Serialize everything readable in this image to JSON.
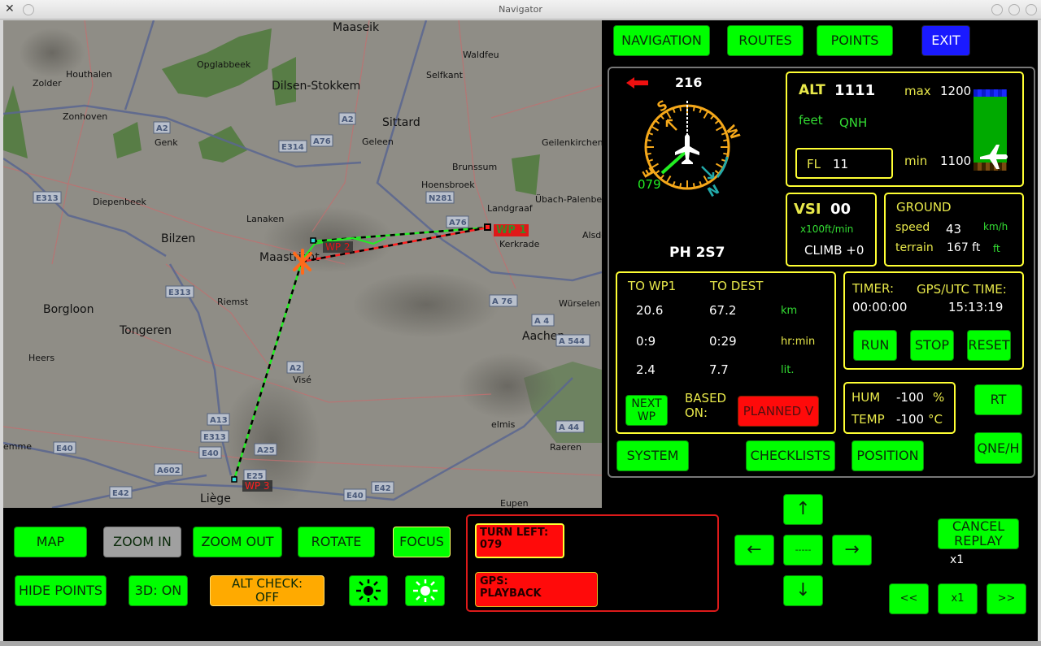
{
  "window": {
    "title": "Navigator"
  },
  "top_nav": {
    "navigation": "NAVIGATION",
    "routes": "ROUTES",
    "points": "POINTS",
    "exit": "EXIT"
  },
  "compass": {
    "heading": "216",
    "bearing": "079",
    "callsign": "PH 2S7",
    "cardinals": {
      "s": "S",
      "w": "W",
      "n": "N",
      "e": "E"
    },
    "turn_direction": "left"
  },
  "altitude": {
    "label": "ALT",
    "value": "1111",
    "unit": "feet",
    "mode": "QNH",
    "max_label": "max",
    "max_value": "1200",
    "min_label": "min",
    "min_value": "1100",
    "fl_label": "FL",
    "fl_value": "11",
    "bar_fraction": 0.11
  },
  "vsi": {
    "label": "VSI",
    "value": "00",
    "unit": "x100ft/min",
    "climb": "CLIMB +0"
  },
  "ground": {
    "title": "GROUND",
    "speed_label": "speed",
    "speed_value": "43",
    "speed_unit": "km/h",
    "terrain_label": "terrain",
    "terrain_value": "167 ft",
    "terrain_unit": "ft"
  },
  "route": {
    "col1": "TO WP1",
    "col2": "TO DEST",
    "rows": [
      {
        "a": "20.6",
        "b": "67.2",
        "unit": "km"
      },
      {
        "a": "0:9",
        "b": "0:29",
        "unit": "hr:min"
      },
      {
        "a": "2.4",
        "b": "7.7",
        "unit": "lit."
      }
    ],
    "next_wp": "NEXT WP",
    "based_on": "BASED ON:",
    "planned": "PLANNED V"
  },
  "timer": {
    "label": "TIMER:",
    "value": "00:00:00",
    "gps_label": "GPS/UTC TIME:",
    "gps_value": "15:13:19",
    "run": "RUN",
    "stop": "STOP",
    "reset": "RESET"
  },
  "weather": {
    "hum_label": "HUM",
    "hum_value": "-100",
    "hum_unit": "%",
    "temp_label": "TEMP",
    "temp_value": "-100",
    "temp_unit": "°C"
  },
  "side_buttons": {
    "rt": "RT",
    "qne": "QNE/H",
    "system": "SYSTEM",
    "checklists": "CHECKLISTS",
    "position": "POSITION"
  },
  "map_buttons": {
    "map": "MAP",
    "zoom_in": "ZOOM IN",
    "zoom_out": "ZOOM OUT",
    "rotate": "ROTATE",
    "focus": "FOCUS",
    "hide_points": "HIDE POINTS",
    "3d": "3D: ON",
    "alt_check": "ALT CHECK: OFF"
  },
  "alerts": {
    "turn": "TURN LEFT:",
    "turn_value": "079",
    "gps": "GPS:",
    "gps_value": "PLAYBACK"
  },
  "pan": {
    "up": "↑",
    "down": "↓",
    "left": "←",
    "right": "→",
    "center": "-----"
  },
  "replay": {
    "cancel": "CANCEL REPLAY",
    "speed": "x1",
    "rew": "<<",
    "x1": "x1",
    "ff": ">>"
  },
  "map": {
    "waypoints": [
      "WP 1",
      "WP 2",
      "WP 3"
    ],
    "places": [
      [
        "Maaseik",
        405,
        0
      ],
      [
        "Waldfeu",
        565,
        33
      ],
      [
        "Houthalen",
        77,
        57
      ],
      [
        "Opglabbeek",
        238,
        45
      ],
      [
        "Dilsen-Stokkem",
        330,
        72
      ],
      [
        "Zolder",
        36,
        68
      ],
      [
        "Selfkant",
        520,
        58
      ],
      [
        "Sittard",
        466,
        117
      ],
      [
        "Zonhoven",
        73,
        109
      ],
      [
        "Genk",
        186,
        141
      ],
      [
        "Geleen",
        441,
        140
      ],
      [
        "Geilenkirchen",
        662,
        141
      ],
      [
        "Brunssum",
        552,
        171
      ],
      [
        "Diepenbeek",
        110,
        214
      ],
      [
        "Hoensbroek",
        514,
        193
      ],
      [
        "Übach-Palenberg",
        654,
        211
      ],
      [
        "Landgraaf",
        595,
        222
      ],
      [
        "Lanaken",
        299,
        235
      ],
      [
        "Bilzen",
        194,
        260
      ],
      [
        "Kerkrade",
        610,
        266
      ],
      [
        "Maastricht",
        315,
        283
      ],
      [
        "Alsdo",
        712,
        255
      ],
      [
        "Riemst",
        263,
        337
      ],
      [
        "Borgloon",
        49,
        347
      ],
      [
        "Tongeren",
        143,
        373
      ],
      [
        "Würselen",
        683,
        339
      ],
      [
        "Aachen",
        638,
        380
      ],
      [
        "Heers",
        31,
        406
      ],
      [
        "Visé",
        356,
        433
      ],
      [
        "elmis",
        600,
        488
      ],
      [
        "emme",
        0,
        515
      ],
      [
        "Raeren",
        672,
        516
      ],
      [
        "Liège",
        242,
        580
      ],
      [
        "Eupen",
        611,
        585
      ]
    ],
    "shields": [
      [
        "A2",
        185,
        125
      ],
      [
        "A2",
        413,
        114
      ],
      [
        "E314",
        339,
        148
      ],
      [
        "A76",
        378,
        141
      ],
      [
        "E313",
        37,
        211
      ],
      [
        "N281",
        520,
        211
      ],
      [
        "A76",
        545,
        241
      ],
      [
        "A 76",
        598,
        338
      ],
      [
        "A 4",
        650,
        362
      ],
      [
        "A 544",
        680,
        387
      ],
      [
        "E313",
        200,
        327
      ],
      [
        "A2",
        349,
        420
      ],
      [
        "A13",
        251,
        484
      ],
      [
        "E313",
        243,
        505
      ],
      [
        "E40",
        241,
        525
      ],
      [
        "A25",
        309,
        521
      ],
      [
        "A602",
        186,
        546
      ],
      [
        "E25",
        296,
        553
      ],
      [
        "E42",
        131,
        574
      ],
      [
        "E40",
        419,
        577
      ],
      [
        "E42",
        453,
        568
      ],
      [
        "E40",
        62,
        519
      ],
      [
        "A 44",
        680,
        493
      ]
    ]
  }
}
